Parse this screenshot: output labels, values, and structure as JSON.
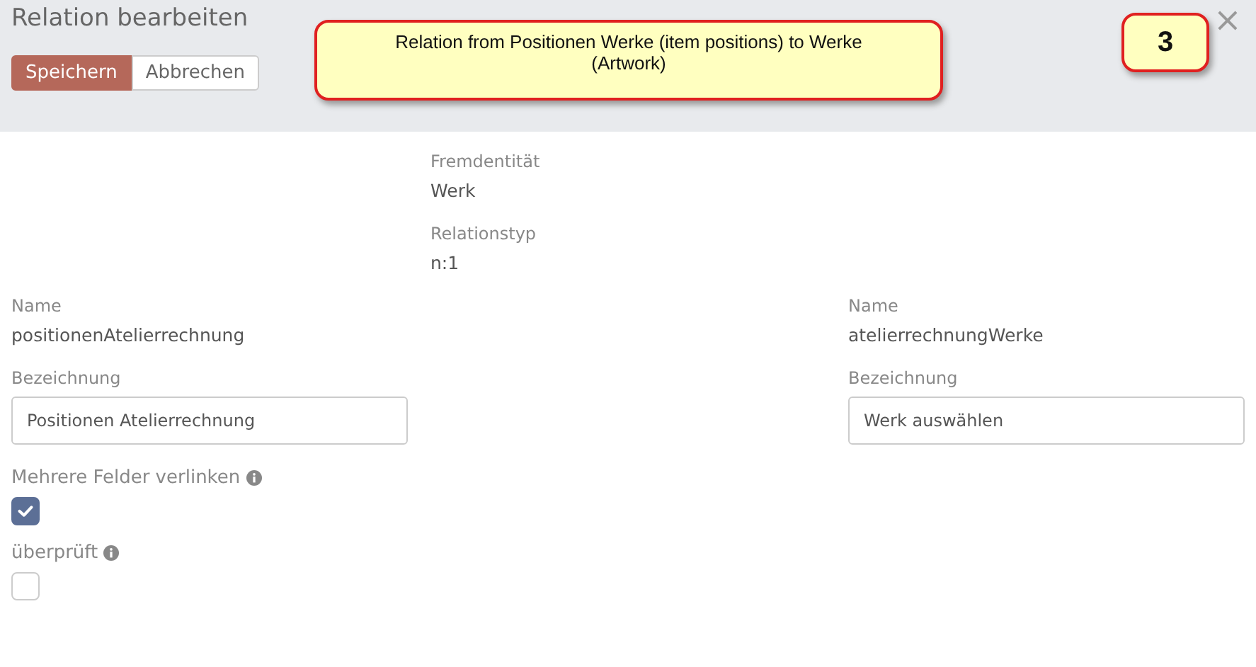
{
  "window": {
    "title": "Relation bearbeiten",
    "close": "×"
  },
  "buttons": [
    {
      "label": "Speichern",
      "primary": true
    },
    {
      "label": "Abbrechen",
      "primary": false
    }
  ],
  "callout": {
    "text": "Relation from Positionen Werke (item positions) to Werke (Artwork)"
  },
  "step_badge": "3",
  "center": [
    {
      "label": "Fremdentität",
      "value": "Werk"
    },
    {
      "label": "Relationstyp",
      "value": "n:1"
    }
  ],
  "left": {
    "name_label": "Name",
    "name": "positionenAtelierrechnung",
    "designation_label": "Bezeichnung",
    "designation": "Positionen Atelierrechnung"
  },
  "right": {
    "name_label": "Name",
    "name": "atelierrechnungWerke",
    "designation_label": "Bezeichnung",
    "designation": "Werk auswählen"
  },
  "options": [
    {
      "label": "Mehrere Felder verlinken",
      "checked": true
    },
    {
      "label": "überprüft",
      "checked": false
    }
  ]
}
